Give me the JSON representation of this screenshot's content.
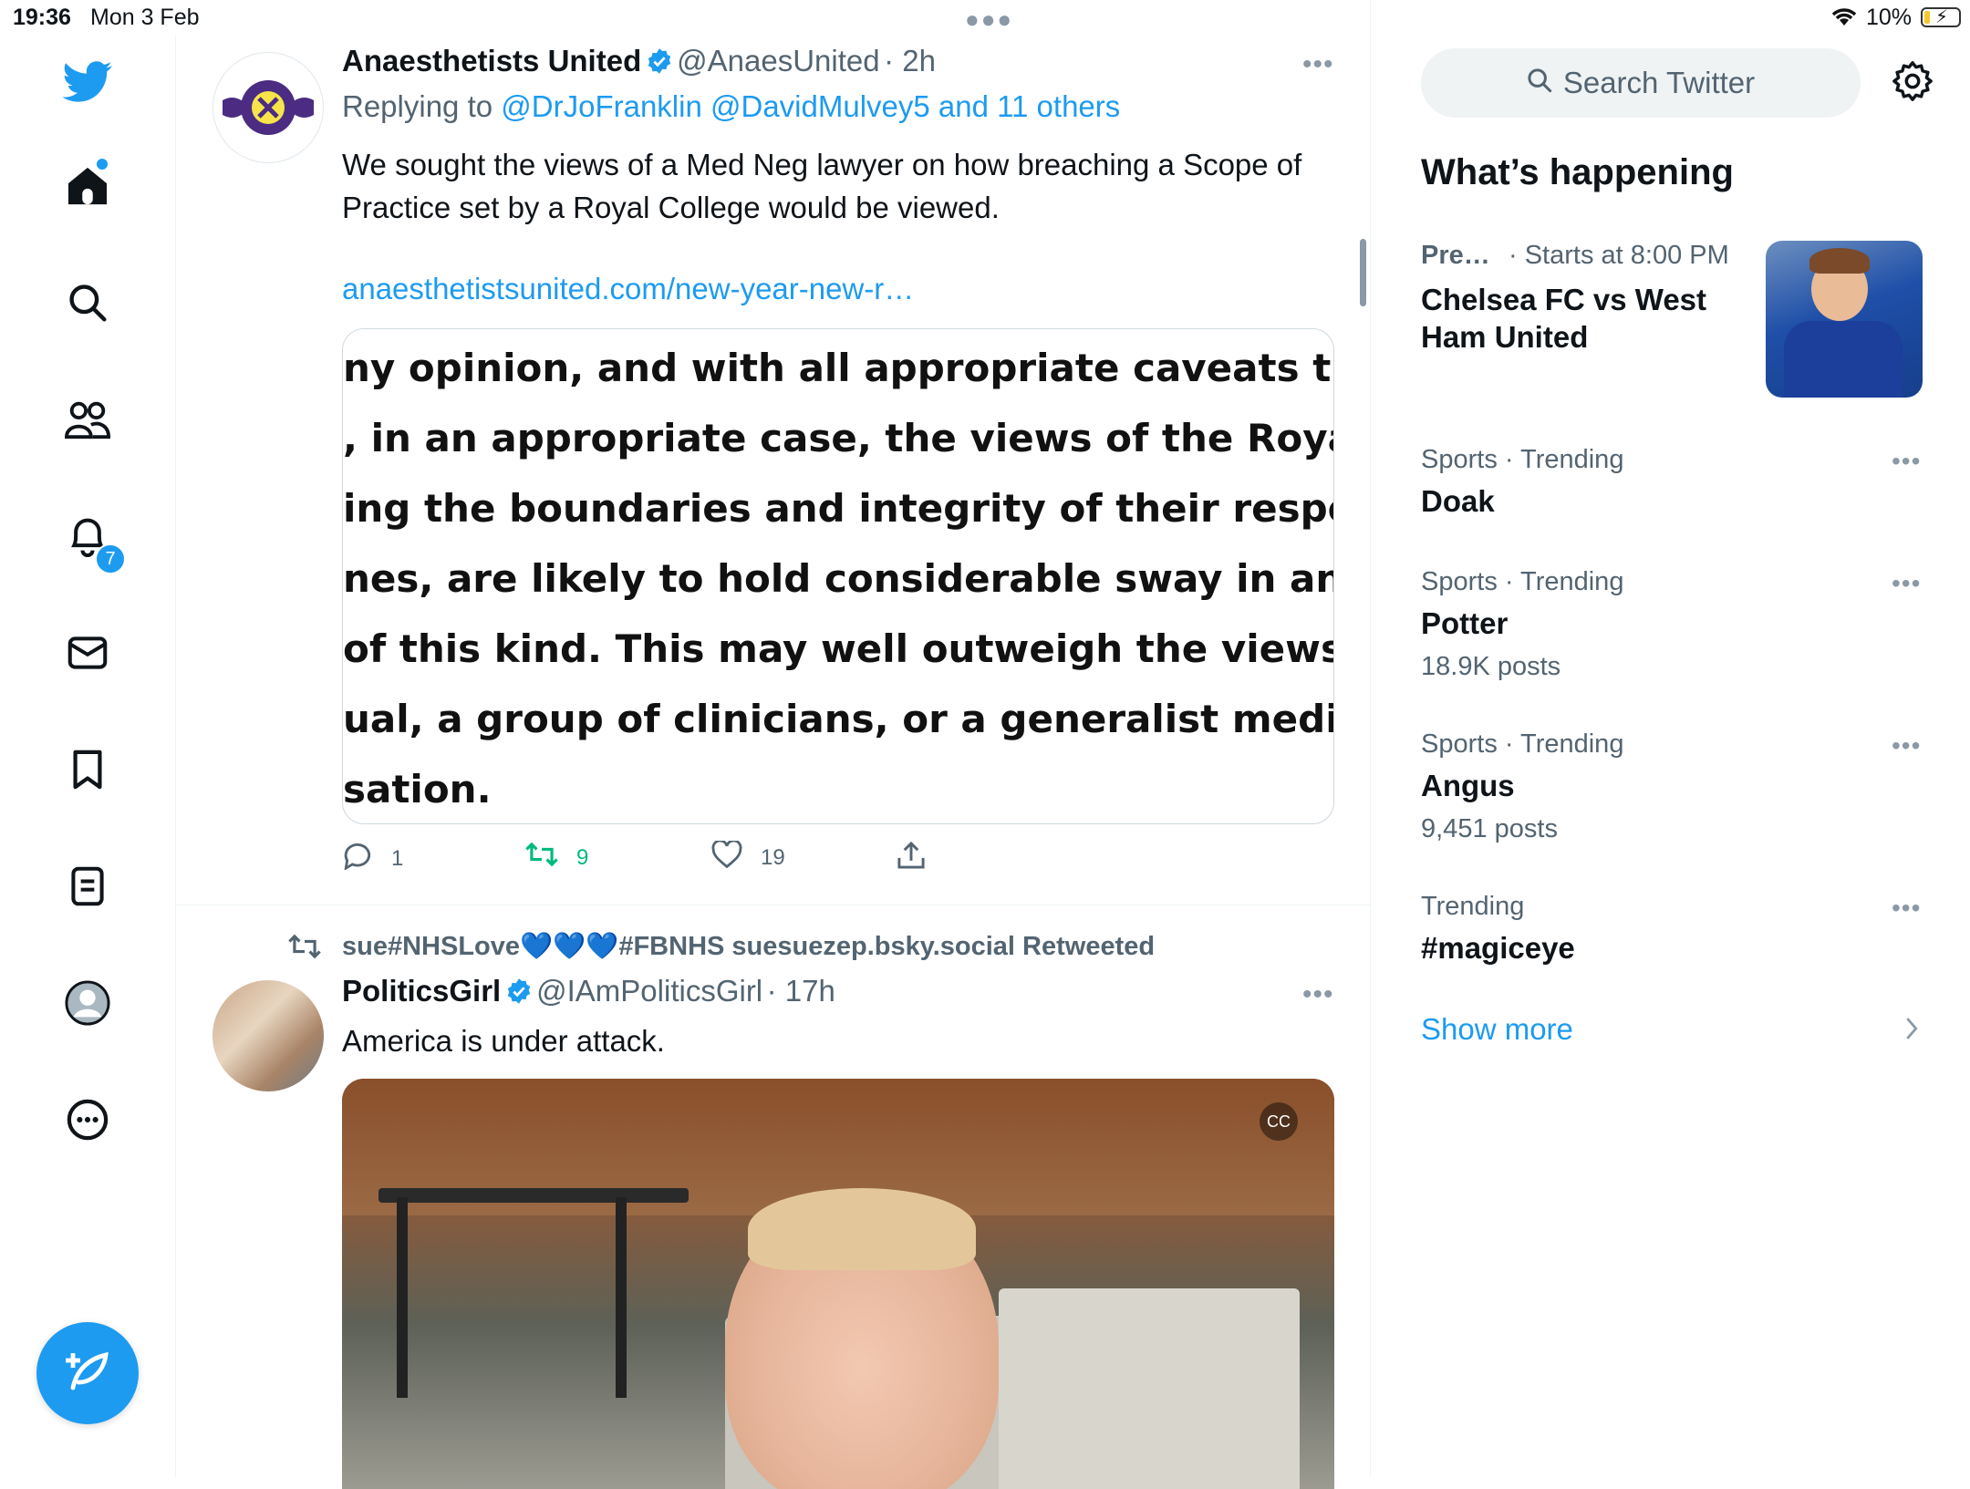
{
  "status_bar": {
    "time": "19:36",
    "date": "Mon 3 Feb",
    "battery": "10%"
  },
  "notifications_badge": "7",
  "tweets": [
    {
      "name": "Anaesthetists United",
      "handle": "@AnaesUnited",
      "time": "· 2h",
      "replying_prefix": "Replying to",
      "replying_to": "@DrJoFranklin @DavidMulvey5 and 11 others",
      "text_line1": "We sought the views of a Med Neg lawyer on how breaching a Scope of",
      "text_line2": "Practice set by a Royal College would be viewed.",
      "link": "anaesthetistsunited.com/new-year-new-r…",
      "quote_lines": [
        "ny opinion, and with all appropriate caveats that",
        ", in an appropriate case, the views of the Royal Co",
        "ing the boundaries and integrity of their respective",
        "nes, are likely to hold considerable sway in any leg",
        "of this kind. This may well outweigh the views of a",
        "ual, a group of clinicians, or a generalist medical",
        "sation."
      ],
      "replies": "1",
      "retweets": "9",
      "likes": "19"
    },
    {
      "retweeted_by": "sue#NHSLove💙💙💙#FBNHS suesuezep.bsky.social Retweeted",
      "name": "PoliticsGirl",
      "handle": "@IAmPoliticsGirl",
      "time": "· 17h",
      "text": "America is under attack."
    }
  ],
  "sidebar": {
    "search_placeholder": "Search Twitter",
    "heading": "What’s happening",
    "event": {
      "meta_left": "Pre…",
      "meta_right": "· Starts at 8:00 PM",
      "title_line1": "Chelsea FC vs West",
      "title_line2": "Ham United"
    },
    "trends": [
      {
        "meta": "Sports · Trending",
        "title": "Doak",
        "posts": ""
      },
      {
        "meta": "Sports · Trending",
        "title": "Potter",
        "posts": "18.9K posts"
      },
      {
        "meta": "Sports · Trending",
        "title": "Angus",
        "posts": "9,451 posts"
      },
      {
        "meta": "Trending",
        "title": "#magiceye",
        "posts": ""
      }
    ],
    "show_more": "Show more"
  },
  "colors": {
    "accent": "#1d9bf0",
    "retweet_green": "#00ba7c",
    "secondary_text": "#536471"
  },
  "icons": [
    "twitter-logo-icon",
    "home-icon",
    "search-icon",
    "communities-icon",
    "bell-icon",
    "mail-icon",
    "bookmark-icon",
    "list-icon",
    "profile-icon",
    "more-circle-icon",
    "compose-icon",
    "gear-icon",
    "reply-icon",
    "retweet-icon",
    "heart-icon",
    "share-icon",
    "verified-icon",
    "chevron-right-icon"
  ]
}
